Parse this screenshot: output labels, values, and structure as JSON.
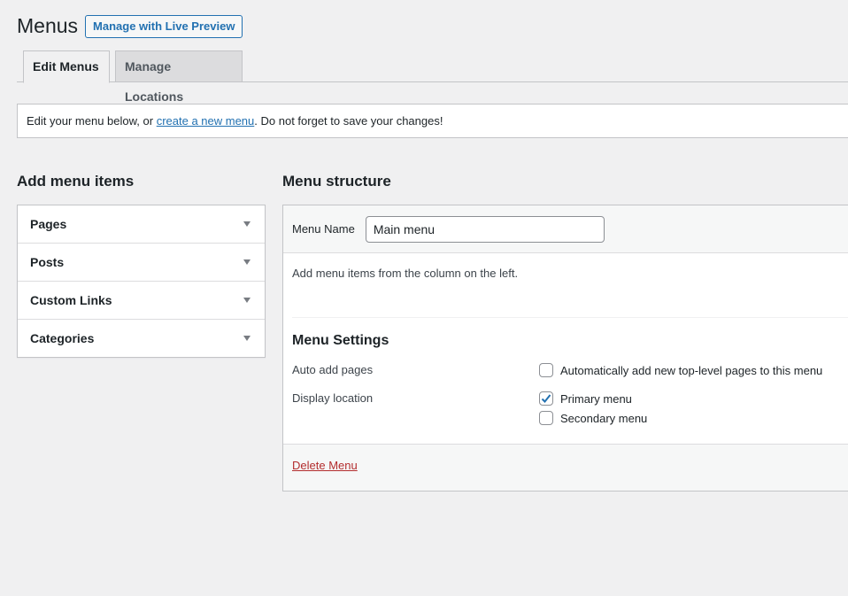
{
  "header": {
    "title": "Menus",
    "live_preview_button": "Manage with Live Preview"
  },
  "tabs": [
    {
      "label": "Edit Menus",
      "active": true
    },
    {
      "label": "Manage Locations",
      "active": false
    }
  ],
  "notice": {
    "prefix": "Edit your menu below, or ",
    "link_text": "create a new menu",
    "suffix": ". Do not forget to save your changes!"
  },
  "add_items": {
    "heading": "Add menu items",
    "sections": [
      {
        "label": "Pages",
        "icon": "triangle-down-icon"
      },
      {
        "label": "Posts",
        "icon": "triangle-down-icon"
      },
      {
        "label": "Custom Links",
        "icon": "triangle-down-icon"
      },
      {
        "label": "Categories",
        "icon": "triangle-down-icon"
      }
    ]
  },
  "structure": {
    "heading": "Menu structure",
    "menu_name_label": "Menu Name",
    "menu_name_value": "Main menu",
    "instruction": "Add menu items from the column on the left.",
    "settings_title": "Menu Settings",
    "auto_add_label": "Auto add pages",
    "auto_add_option": {
      "label": "Automatically add new top-level pages to this menu",
      "checked": false
    },
    "display_location_label": "Display location",
    "locations": [
      {
        "label": "Primary menu",
        "checked": true
      },
      {
        "label": "Secondary menu",
        "checked": false
      }
    ],
    "delete_link": "Delete Menu"
  },
  "colors": {
    "accent": "#2271b1",
    "danger": "#b32d2e",
    "background": "#f0f0f1"
  }
}
